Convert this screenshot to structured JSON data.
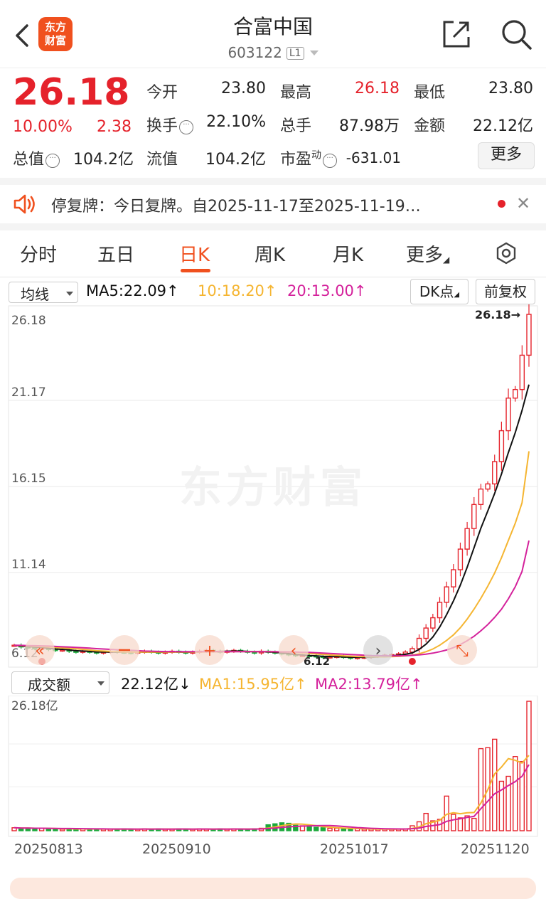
{
  "header": {
    "logo_line1": "东方",
    "logo_line2": "财富",
    "title": "合富中国",
    "code": "603122",
    "level": "L1"
  },
  "quote": {
    "price": "26.18",
    "change_pct": "10.00%",
    "change": "2.38",
    "fields": {
      "open_label": "今开",
      "open": "23.80",
      "high_label": "最高",
      "high": "26.18",
      "low_label": "最低",
      "low": "23.80",
      "turnover_label": "换手",
      "turnover": "22.10%",
      "volume_label": "总手",
      "volume": "87.98万",
      "amount_label": "金额",
      "amount": "22.12亿",
      "mktcap_label": "总值",
      "mktcap": "104.2亿",
      "float_label": "流值",
      "float": "104.2亿",
      "pe_label": "市盈",
      "pe_sup": "动",
      "pe": "-631.01"
    },
    "more_label": "更多"
  },
  "notice": {
    "text": "停复牌：今日复牌。自2025-11-17至2025-11-19…"
  },
  "tabs": [
    "分时",
    "五日",
    "日K",
    "周K",
    "月K",
    "更多"
  ],
  "active_tab": 2,
  "indicators": {
    "ma_select": "均线",
    "ma5": "MA5:22.09",
    "ma10": "10:18.20",
    "ma20": "20:13.00",
    "dk_label": "DK点",
    "adjust_label": "前复权",
    "vol_select": "成交额",
    "vol_now": "22.12亿",
    "vol_ma1": "MA1:15.95亿",
    "vol_ma2": "MA2:13.79亿",
    "arrow_up": "↑",
    "arrow_down": "↓"
  },
  "colors": {
    "up": "#e5222b",
    "down": "#1aa83a",
    "ma5": "#111111",
    "ma10": "#f5b531",
    "ma20": "#d4219b",
    "accent": "#f0501e"
  },
  "chart_data": {
    "type": "candlestick",
    "y_ticks": [
      "26.18",
      "21.17",
      "16.15",
      "11.14",
      "6.12"
    ],
    "ylim": [
      6.12,
      26.18
    ],
    "last_price_label": "26.18→",
    "low_marker_label": "6.12",
    "x_labels": [
      "20250813",
      "20250910",
      "20251017",
      "20251120"
    ],
    "volume_top_label": "26.18亿",
    "volume_ylim": [
      0,
      26.18
    ],
    "closes": [
      6.9,
      6.8,
      6.75,
      6.7,
      6.72,
      6.65,
      6.6,
      6.62,
      6.55,
      6.5,
      6.55,
      6.5,
      6.45,
      6.5,
      6.55,
      6.5,
      6.48,
      6.45,
      6.5,
      6.55,
      6.5,
      6.45,
      6.5,
      6.55,
      6.5,
      6.45,
      6.5,
      6.55,
      6.6,
      6.55,
      6.5,
      6.55,
      6.6,
      6.55,
      6.5,
      6.45,
      6.55,
      6.5,
      6.45,
      6.4,
      6.35,
      6.3,
      6.3,
      6.28,
      6.25,
      6.2,
      6.22,
      6.25,
      6.2,
      6.15,
      6.18,
      6.2,
      6.25,
      6.3,
      6.32,
      6.35,
      6.4,
      6.5,
      6.7,
      7.3,
      7.9,
      8.5,
      9.4,
      10.3,
      11.3,
      12.5,
      13.7,
      15.1,
      16.0,
      16.3,
      17.6,
      19.4,
      21.3,
      21.8,
      23.8,
      26.18
    ],
    "volumes": [
      0.6,
      0.5,
      0.5,
      0.4,
      0.5,
      0.4,
      0.4,
      0.3,
      0.4,
      0.3,
      0.4,
      0.3,
      0.4,
      0.3,
      0.3,
      0.3,
      0.4,
      0.3,
      0.3,
      0.4,
      0.3,
      0.4,
      0.3,
      0.3,
      0.4,
      0.3,
      0.3,
      0.4,
      0.3,
      0.3,
      0.4,
      0.3,
      0.4,
      0.3,
      0.3,
      0.4,
      0.5,
      1.2,
      1.4,
      1.6,
      1.5,
      1.1,
      1.0,
      0.8,
      0.7,
      0.6,
      0.5,
      0.5,
      0.4,
      0.4,
      0.4,
      0.3,
      0.3,
      0.3,
      0.3,
      0.3,
      0.4,
      0.4,
      1.0,
      1.8,
      3.5,
      2.0,
      2.3,
      7.0,
      3.3,
      2.6,
      3.0,
      2.5,
      16.6,
      16.8,
      18.5,
      10.0,
      11.0,
      15.0,
      14.0,
      26.18
    ],
    "ma5": [
      6.9,
      6.85,
      6.82,
      6.79,
      6.77,
      6.72,
      6.68,
      6.66,
      6.63,
      6.58,
      6.56,
      6.54,
      6.51,
      6.5,
      6.51,
      6.5,
      6.5,
      6.5,
      6.5,
      6.51,
      6.5,
      6.49,
      6.5,
      6.51,
      6.5,
      6.49,
      6.5,
      6.51,
      6.52,
      6.53,
      6.54,
      6.55,
      6.56,
      6.56,
      6.54,
      6.53,
      6.53,
      6.51,
      6.49,
      6.45,
      6.41,
      6.36,
      6.33,
      6.3,
      6.28,
      6.25,
      6.24,
      6.23,
      6.22,
      6.2,
      6.2,
      6.2,
      6.2,
      6.22,
      6.25,
      6.28,
      6.32,
      6.37,
      6.45,
      6.65,
      6.96,
      7.38,
      7.96,
      8.68,
      9.48,
      10.4,
      11.44,
      12.58,
      13.72,
      14.72,
      15.74,
      16.88,
      18.12,
      19.28,
      20.58,
      22.09
    ],
    "ma10": [
      6.9,
      6.88,
      6.86,
      6.84,
      6.82,
      6.8,
      6.77,
      6.74,
      6.72,
      6.69,
      6.66,
      6.62,
      6.58,
      6.56,
      6.54,
      6.52,
      6.51,
      6.5,
      6.5,
      6.5,
      6.5,
      6.5,
      6.5,
      6.5,
      6.5,
      6.5,
      6.5,
      6.5,
      6.51,
      6.51,
      6.52,
      6.52,
      6.53,
      6.53,
      6.53,
      6.53,
      6.53,
      6.53,
      6.52,
      6.51,
      6.5,
      6.48,
      6.45,
      6.42,
      6.39,
      6.36,
      6.33,
      6.31,
      6.28,
      6.26,
      6.24,
      6.23,
      6.22,
      6.22,
      6.22,
      6.23,
      6.25,
      6.28,
      6.32,
      6.4,
      6.52,
      6.68,
      6.9,
      7.18,
      7.5,
      7.92,
      8.42,
      9.0,
      9.64,
      10.34,
      11.1,
      12.0,
      13.0,
      14.0,
      15.2,
      18.2
    ],
    "ma20": [
      6.9,
      6.89,
      6.88,
      6.87,
      6.86,
      6.85,
      6.83,
      6.81,
      6.79,
      6.77,
      6.75,
      6.73,
      6.7,
      6.68,
      6.66,
      6.64,
      6.62,
      6.6,
      6.58,
      6.56,
      6.55,
      6.54,
      6.53,
      6.53,
      6.52,
      6.52,
      6.52,
      6.52,
      6.52,
      6.52,
      6.52,
      6.52,
      6.52,
      6.52,
      6.52,
      6.52,
      6.52,
      6.52,
      6.52,
      6.51,
      6.51,
      6.5,
      6.49,
      6.48,
      6.46,
      6.44,
      6.42,
      6.4,
      6.38,
      6.36,
      6.34,
      6.32,
      6.3,
      6.29,
      6.28,
      6.28,
      6.28,
      6.29,
      6.31,
      6.34,
      6.38,
      6.44,
      6.52,
      6.62,
      6.76,
      6.94,
      7.16,
      7.42,
      7.74,
      8.1,
      8.52,
      9.0,
      9.6,
      10.3,
      11.2,
      13.0
    ]
  }
}
